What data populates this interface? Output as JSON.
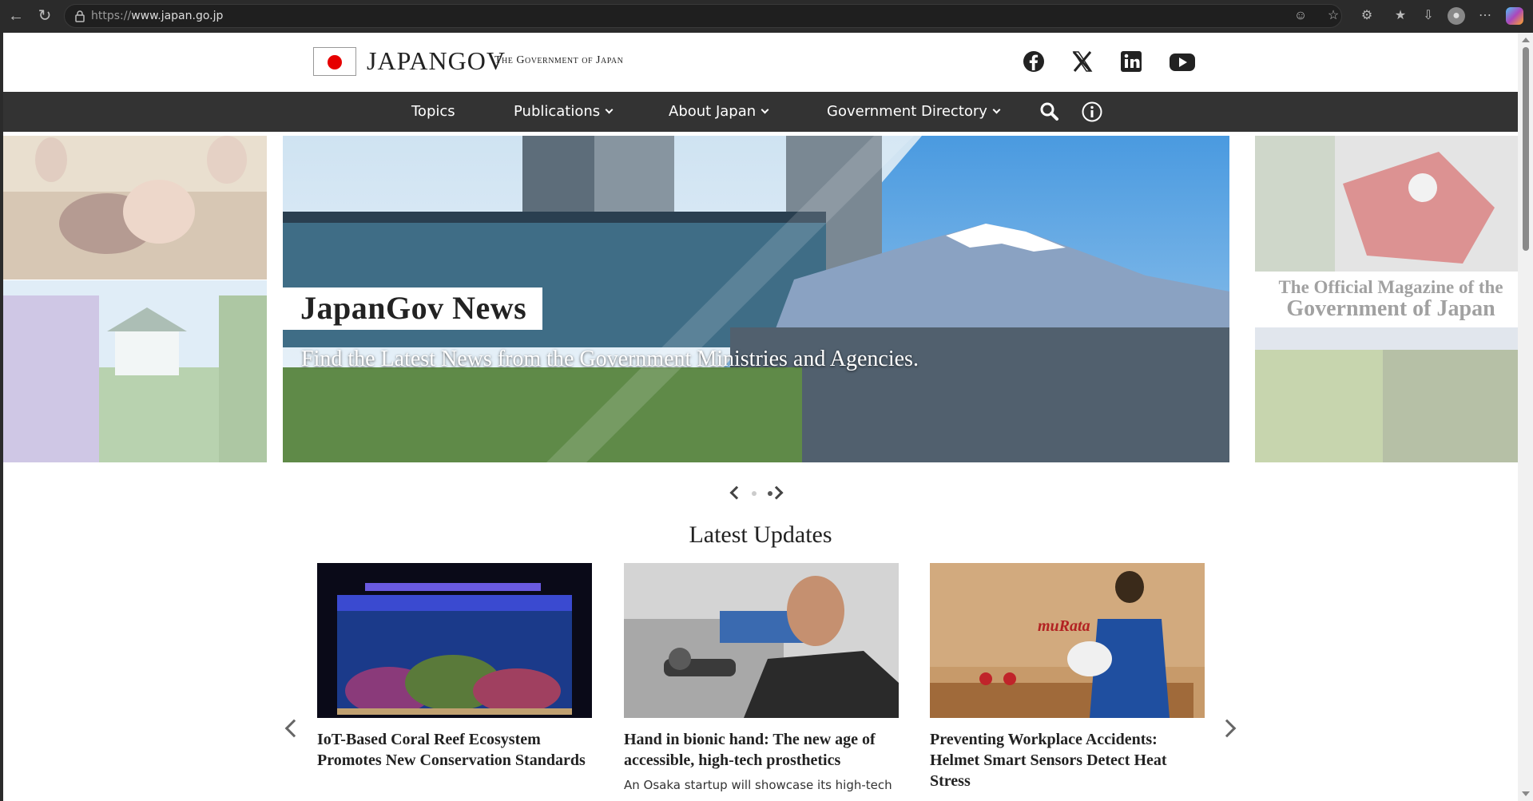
{
  "browser": {
    "url_protocol": "https://",
    "url_host": "www.japan.go.jp"
  },
  "header": {
    "logo_main": "JAPANGOV",
    "logo_sub": "The Government of Japan",
    "social": [
      "facebook-icon",
      "x-icon",
      "linkedin-icon",
      "youtube-icon"
    ]
  },
  "nav": {
    "items": [
      {
        "label": "Topics",
        "has_dropdown": false
      },
      {
        "label": "Publications",
        "has_dropdown": true
      },
      {
        "label": "About Japan",
        "has_dropdown": true
      },
      {
        "label": "Government Directory",
        "has_dropdown": true
      }
    ],
    "icons": [
      "search-icon",
      "info-icon"
    ]
  },
  "carousel": {
    "main": {
      "title": "JapanGov News",
      "subtitle": "Find the Latest News from the Government Ministries and Agencies."
    },
    "right": {
      "line1": "The Official Magazine of the",
      "line2": "Government of Japan"
    },
    "active_index": 1,
    "slide_count": 2
  },
  "latest": {
    "title": "Latest Updates",
    "cards": [
      {
        "title": "IoT-Based Coral Reef Ecosystem Promotes New Conservation Standards",
        "excerpt": ""
      },
      {
        "title": "Hand in bionic hand: The new age of accessible, high-tech prosthetics",
        "excerpt": "An Osaka startup will showcase its high-tech"
      },
      {
        "title": "Preventing Workplace Accidents: Helmet Smart Sensors Detect Heat Stress",
        "excerpt": ""
      }
    ]
  },
  "colors": {
    "nav_bg": "#333333",
    "flag_red": "#e60000",
    "chrome_bg": "#2b2b2b"
  }
}
